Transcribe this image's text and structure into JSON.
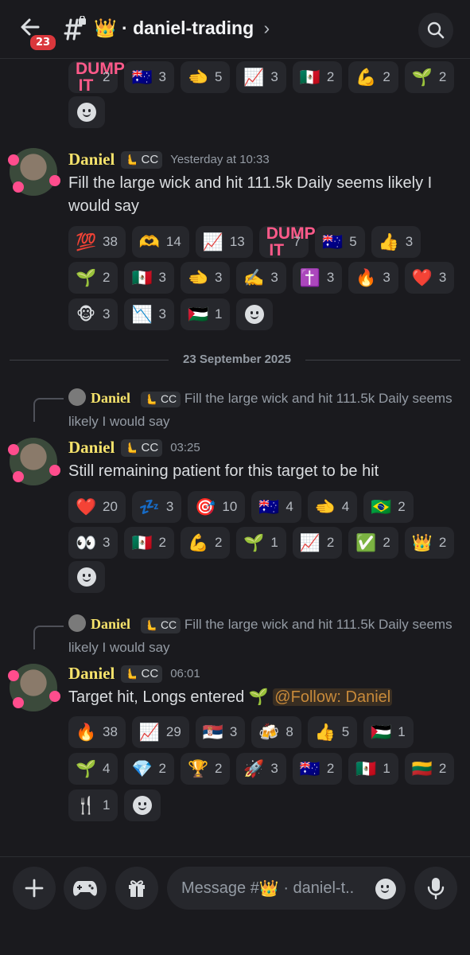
{
  "header": {
    "unread_count": "23",
    "channel_emoji": "👑",
    "channel_name": "daniel-trading",
    "separator": "·",
    "chevron": "›",
    "icons": [
      "back-arrow-icon",
      "locked-channel-icon",
      "search-icon"
    ]
  },
  "top_reactions": {
    "row1": [
      {
        "e": "DUMP IT",
        "n": "2",
        "custom": "dump"
      },
      {
        "e": "🇦🇺",
        "n": "3"
      },
      {
        "e": "🫲",
        "n": "5"
      },
      {
        "e": "📈",
        "n": "3"
      },
      {
        "e": "🇲🇽",
        "n": "2"
      },
      {
        "e": "💪",
        "n": "2"
      },
      {
        "e": "🌱",
        "n": "2"
      }
    ]
  },
  "messages": [
    {
      "username": "Daniel",
      "tag": "CC",
      "tag_icon": "🫷",
      "timestamp": "Yesterday at 10:33",
      "text_line1": "Fill the large wick and hit 111.5k Daily seems likely I",
      "text_line2": "would say",
      "reactions": {
        "row1": [
          {
            "e": "💯",
            "n": "38"
          },
          {
            "e": "🫶",
            "n": "14"
          },
          {
            "e": "📈",
            "n": "13"
          },
          {
            "e": "DUMP IT",
            "n": "7",
            "custom": "dump"
          },
          {
            "e": "🇦🇺",
            "n": "5"
          },
          {
            "e": "👍",
            "n": "3"
          }
        ],
        "row2": [
          {
            "e": "🌱",
            "n": "2"
          },
          {
            "e": "🇲🇽",
            "n": "3"
          },
          {
            "e": "🫲",
            "n": "3"
          },
          {
            "e": "✍️",
            "n": "3"
          },
          {
            "e": "✝️",
            "n": "3"
          },
          {
            "e": "🔥",
            "n": "3"
          },
          {
            "e": "❤️",
            "n": "3"
          }
        ],
        "row3": [
          {
            "e": "🐵",
            "n": "3"
          },
          {
            "e": "📉",
            "n": "3"
          },
          {
            "e": "🇵🇸",
            "n": "1"
          }
        ]
      }
    },
    {
      "reply_user": "Daniel",
      "reply_tag": "CC",
      "reply_text_line1": "Fill the large wick and hit 111.5k Daily seems",
      "reply_text_line2": "likely I would say",
      "username": "Daniel",
      "tag": "CC",
      "tag_icon": "🫷",
      "timestamp": "03:25",
      "text_line1": "Still remaining patient for this target to be hit",
      "reactions": {
        "row1": [
          {
            "e": "❤️",
            "n": "20"
          },
          {
            "e": "💤",
            "n": "3"
          },
          {
            "e": "🎯",
            "n": "10"
          },
          {
            "e": "🇦🇺",
            "n": "4"
          },
          {
            "e": "🫲",
            "n": "4"
          },
          {
            "e": "🇧🇷",
            "n": "2"
          }
        ],
        "row2": [
          {
            "e": "👀",
            "n": "3"
          },
          {
            "e": "🇲🇽",
            "n": "2"
          },
          {
            "e": "💪",
            "n": "2"
          },
          {
            "e": "🌱",
            "n": "1"
          },
          {
            "e": "📈",
            "n": "2"
          },
          {
            "e": "✅",
            "n": "2"
          },
          {
            "e": "👑",
            "n": "2"
          }
        ]
      }
    },
    {
      "reply_user": "Daniel",
      "reply_tag": "CC",
      "reply_text_line1": "Fill the large wick and hit 111.5k Daily seems",
      "reply_text_line2": "likely I would say",
      "username": "Daniel",
      "tag": "CC",
      "tag_icon": "🫷",
      "timestamp": "06:01",
      "text_line1": "Target hit, Longs entered",
      "text_emoji": "🌱",
      "mention": "@Follow: Daniel",
      "reactions": {
        "row1": [
          {
            "e": "🔥",
            "n": "38"
          },
          {
            "e": "📈",
            "n": "29"
          },
          {
            "e": "🇷🇸",
            "n": "3"
          },
          {
            "e": "🍻",
            "n": "8"
          },
          {
            "e": "👍",
            "n": "5"
          },
          {
            "e": "🇵🇸",
            "n": "1"
          }
        ],
        "row2": [
          {
            "e": "🌱",
            "n": "4"
          },
          {
            "e": "💎",
            "n": "2"
          },
          {
            "e": "🏆",
            "n": "2"
          },
          {
            "e": "🚀",
            "n": "3"
          },
          {
            "e": "🇦🇺",
            "n": "2"
          },
          {
            "e": "🇲🇽",
            "n": "1"
          },
          {
            "e": "🇱🇹",
            "n": "2"
          }
        ],
        "row3": [
          {
            "e": "🍴",
            "n": "1"
          }
        ]
      }
    }
  ],
  "date_divider": "23 September 2025",
  "composer": {
    "placeholder_prefix": "Message #",
    "placeholder_emoji": "👑",
    "placeholder_suffix": "· daniel-t..",
    "icons": [
      "plus-icon",
      "gamepad-icon",
      "gift-icon",
      "emoji-icon",
      "microphone-icon"
    ]
  }
}
